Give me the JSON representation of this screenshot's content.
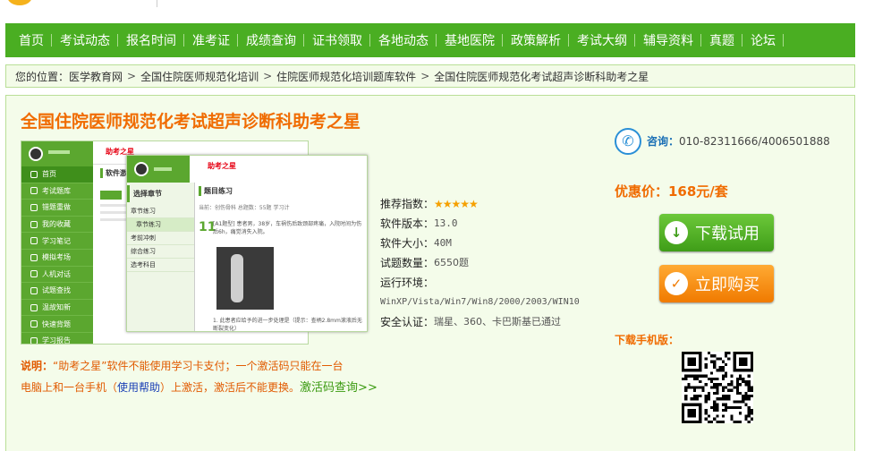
{
  "nav": {
    "items": [
      "首页",
      "考试动态",
      "报名时间",
      "准考证",
      "成绩查询",
      "证书领取",
      "各地动态",
      "基地医院",
      "政策解析",
      "考试大纲",
      "辅导资料",
      "真题",
      "论坛"
    ]
  },
  "breadcrumb": {
    "prefix": "您的位置：",
    "items": [
      "医学教育网",
      "全国住院医师规范化培训",
      "住院医师规范化培训题库软件",
      "全国住院医师规范化考试超声诊断科助考之星"
    ],
    "separator": ">"
  },
  "product": {
    "title": "全国住院医师规范化考试超声诊断科助考之星",
    "specs": {
      "rating_label": "推荐指数：",
      "rating_stars": "★★★★★",
      "version_label": "软件版本：",
      "version": "13.0",
      "size_label": "软件大小：",
      "size": "40M",
      "questions_label": "试题数量：",
      "questions": "6550题",
      "env_label": "运行环境：",
      "env": "WinXP/Vista/Win7/Win8/2000/2003/WIN10",
      "security_label": "安全认证：",
      "security": "瑞星、360、卡巴斯基已通过"
    },
    "note": {
      "label": "说明：",
      "text1": "“助考之星”软件不能使用学习卡支付；一个激活码只能在一台",
      "text2a": "电脑上和一台手机（",
      "help_link": "使用帮助",
      "text2b": "）上激活，激活后不能更换。",
      "activation_link": "激活码查询>>"
    }
  },
  "sidebar": {
    "consult_label": "咨询：",
    "phone": "010-82311666/4006501888",
    "price": "优惠价：168元/套",
    "download_button": "下载试用",
    "buy_button": "立即购买",
    "mobile_label": "下载手机版："
  },
  "screenshot": {
    "back_logo": "助考之星",
    "back_menu": [
      "首页",
      "考试题库",
      "错题重做",
      "我的收藏",
      "学习笔记",
      "模拟考场",
      "人机对话",
      "试题查找",
      "温故知新",
      "快速背题",
      "学习报告"
    ],
    "back_panel_title": "软件激活",
    "front_logo": "助考之星",
    "chapter_title": "选择章节",
    "chapter_rows": [
      "章节练习",
      "章节练习",
      "考前冲刺",
      "综合练习",
      "选考科目"
    ],
    "quiz_title": "题目练习",
    "quiz_meta": "当前：创伤骨科    总题数：55题    学习计",
    "qnum": "11",
    "qtext": "[A1题型] 患者男，38岁，车祸伤后致颈部疼痛，入院时间为伤后6h，痛觉消失入院。",
    "qopt": "1. 此患者应给予的进一步处理是（提示：查柄2.8mm滚液后无断裂变化）"
  },
  "colors": {
    "nav_green": "#4aae22",
    "title_orange": "#f06b00",
    "download_green": "#3f9d18",
    "buy_orange": "#f07a00",
    "content_bg": "#f4fcea"
  }
}
